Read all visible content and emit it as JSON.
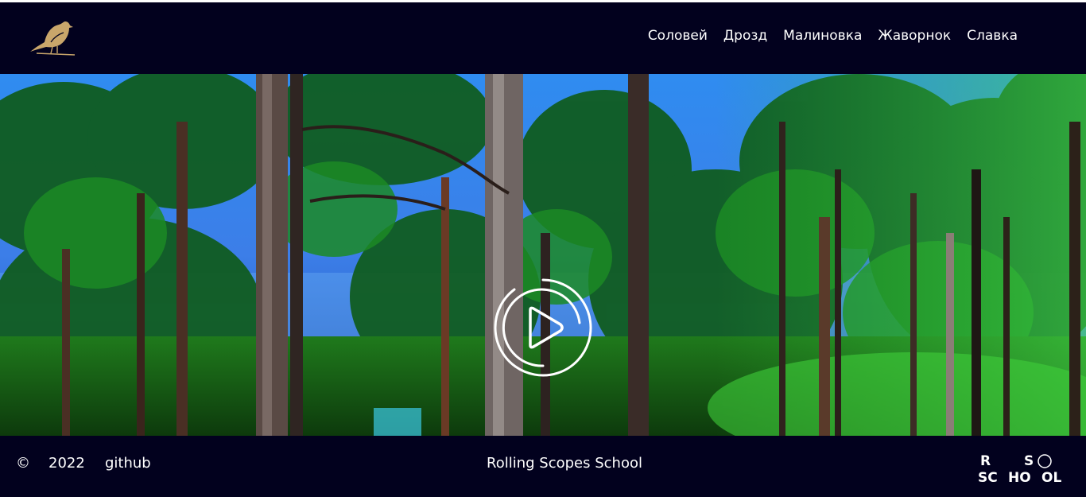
{
  "header": {
    "logo_icon": "bird-logo-icon",
    "nav": [
      {
        "label": "Соловей"
      },
      {
        "label": "Дрозд"
      },
      {
        "label": "Малиновка"
      },
      {
        "label": "Жаворнок"
      },
      {
        "label": "Славка"
      }
    ]
  },
  "hero": {
    "play_icon": "play-circle-icon"
  },
  "footer": {
    "copyright_symbol": "©",
    "year": "2022",
    "github_label": "github",
    "school_label": "Rolling Scopes School",
    "rss_logo_letters": [
      "R",
      "S",
      "SC",
      "HO",
      "OL"
    ]
  },
  "colors": {
    "header_bg": "#02011e",
    "footer_bg": "#02011e",
    "logo_gold": "#c9a66b",
    "text": "#ffffff"
  }
}
